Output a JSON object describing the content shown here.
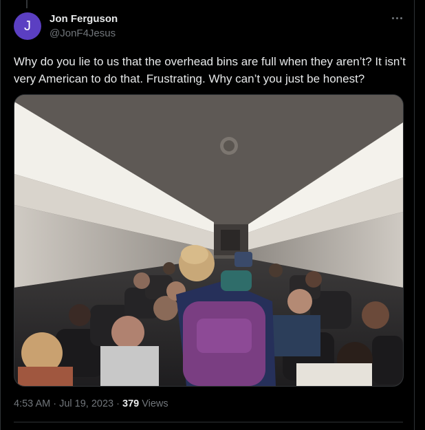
{
  "tweet": {
    "author_name": "Jon Ferguson",
    "author_handle": "@JonF4Jesus",
    "avatar_initial": "J",
    "avatar_color": "#5b3fc2",
    "text": "Why do you lie to us that the overhead bins are full when they aren’t? It isn’t very American to do that. Frustrating. Why can’t you just be honest?",
    "time": "4:53 AM",
    "separator": " · ",
    "date": "Jul 19, 2023",
    "views_count": "379",
    "views_label": " Views"
  },
  "icons": {
    "more": "more-horizontal-icon"
  },
  "colors": {
    "background": "#000000",
    "text_primary": "#e7e9ea",
    "text_secondary": "#71767b",
    "border": "#2f3336"
  }
}
